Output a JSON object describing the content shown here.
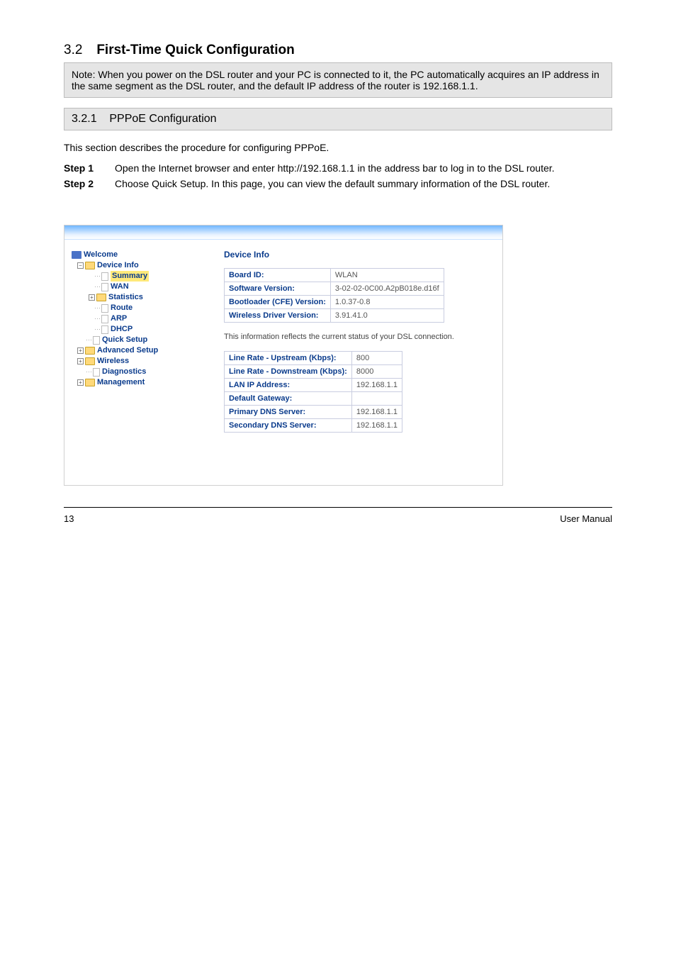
{
  "doc": {
    "section_num": "3.2",
    "section_title": "First-Time Quick Configuration",
    "note_box": "Note: When you power on the DSL router and your PC is connected to it, the PC automatically acquires an IP address in the same segment as the DSL router, and the default IP address of the router is 192.168.1.1.",
    "subsection_num": "3.2.1",
    "subsection_title": "PPPoE Configuration",
    "intro": "This section describes the procedure for configuring PPPoE.",
    "step1_label": "Step 1",
    "step1": "Open the Internet browser and enter http://192.168.1.1 in the address bar to log in to the DSL router.",
    "step2_label": "Step 2",
    "step2": "Choose Quick Setup. In this page, you can view the default summary information of the DSL router."
  },
  "inner": {
    "tree": {
      "welcome": "Welcome",
      "device_info": "Device Info",
      "summary": "Summary",
      "wan": "WAN",
      "statistics": "Statistics",
      "route": "Route",
      "arp": "ARP",
      "dhcp": "DHCP",
      "quick_setup": "Quick Setup",
      "advanced_setup": "Advanced Setup",
      "wireless": "Wireless",
      "diagnostics": "Diagnostics",
      "management": "Management"
    },
    "pane": {
      "title": "Device Info",
      "board_id_k": "Board ID:",
      "board_id_v": "WLAN",
      "sw_ver_k": "Software Version:",
      "sw_ver_v": "3-02-02-0C00.A2pB018e.d16f",
      "bl_ver_k": "Bootloader (CFE) Version:",
      "bl_ver_v": "1.0.37-0.8",
      "wdrv_k": "Wireless Driver Version:",
      "wdrv_v": "3.91.41.0",
      "desc": "This information reflects the current status of your DSL connection.",
      "up_k": "Line Rate - Upstream (Kbps):",
      "up_v": "800",
      "down_k": "Line Rate - Downstream (Kbps):",
      "down_v": "8000",
      "lan_k": "LAN IP Address:",
      "lan_v": "192.168.1.1",
      "gw_k": "Default Gateway:",
      "gw_v": "",
      "pdns_k": "Primary DNS Server:",
      "pdns_v": "192.168.1.1",
      "sdns_k": "Secondary DNS Server:",
      "sdns_v": "192.168.1.1"
    }
  },
  "footer": {
    "page": "13",
    "title": "User Manual"
  }
}
